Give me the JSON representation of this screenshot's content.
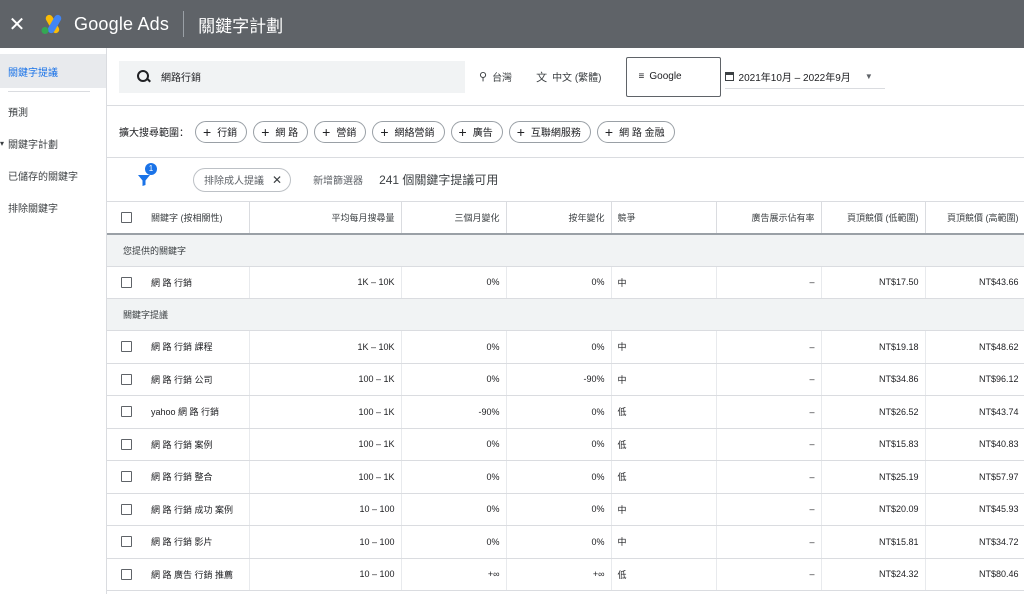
{
  "topbar": {
    "brand": "Google Ads",
    "page_title": "關鍵字計劃",
    "close_icon": "close-icon"
  },
  "sidebar": {
    "items": [
      {
        "label": "關鍵字提議"
      },
      {
        "label": "預測"
      },
      {
        "label": "關鍵字計劃"
      },
      {
        "label": "已儲存的關鍵字"
      },
      {
        "label": "排除關鍵字"
      }
    ]
  },
  "search": {
    "value": "網路行銷",
    "location": "台灣",
    "language": "中文 (繁體)",
    "network": "Google",
    "date_range": "2021年10月 – 2022年9月"
  },
  "expand": {
    "label": "擴大搜尋範圍：",
    "chips": [
      "行銷",
      "網 路",
      "營銷",
      "網絡營銷",
      "廣告",
      "互聯網服務",
      "網 路 金融"
    ]
  },
  "filter": {
    "badge": "1",
    "chip_label": "排除成人提議",
    "add_filter": "新增篩選器",
    "count_text": "241 個關鍵字提議可用"
  },
  "table": {
    "headers": [
      "關鍵字 (按相關性)",
      "平均每月搜尋量",
      "三個月變化",
      "按年變化",
      "競爭",
      "廣告展示佔有率",
      "頁頂競價 (低範圍)",
      "頁頂競價 (高範圍)"
    ],
    "group1": "您提供的關鍵字",
    "group2": "關鍵字提議",
    "provided": [
      {
        "keyword": "網 路 行銷",
        "volume": "1K – 10K",
        "three_month": "0%",
        "yoy": "0%",
        "competition": "中",
        "share": "–",
        "low": "NT$17.50",
        "high": "NT$43.66"
      }
    ],
    "ideas": [
      {
        "keyword": "網 路 行銷 課程",
        "volume": "1K – 10K",
        "three_month": "0%",
        "yoy": "0%",
        "competition": "中",
        "share": "–",
        "low": "NT$19.18",
        "high": "NT$48.62"
      },
      {
        "keyword": "網 路 行銷 公司",
        "volume": "100 – 1K",
        "three_month": "0%",
        "yoy": "-90%",
        "competition": "中",
        "share": "–",
        "low": "NT$34.86",
        "high": "NT$96.12"
      },
      {
        "keyword": "yahoo 網 路 行銷",
        "volume": "100 – 1K",
        "three_month": "-90%",
        "yoy": "0%",
        "competition": "低",
        "share": "–",
        "low": "NT$26.52",
        "high": "NT$43.74"
      },
      {
        "keyword": "網 路 行銷 案例",
        "volume": "100 – 1K",
        "three_month": "0%",
        "yoy": "0%",
        "competition": "低",
        "share": "–",
        "low": "NT$15.83",
        "high": "NT$40.83"
      },
      {
        "keyword": "網 路 行銷 整合",
        "volume": "100 – 1K",
        "three_month": "0%",
        "yoy": "0%",
        "competition": "低",
        "share": "–",
        "low": "NT$25.19",
        "high": "NT$57.97"
      },
      {
        "keyword": "網 路 行銷 成功 案例",
        "volume": "10 – 100",
        "three_month": "0%",
        "yoy": "0%",
        "competition": "中",
        "share": "–",
        "low": "NT$20.09",
        "high": "NT$45.93"
      },
      {
        "keyword": "網 路 行銷 影片",
        "volume": "10 – 100",
        "three_month": "0%",
        "yoy": "0%",
        "competition": "中",
        "share": "–",
        "low": "NT$15.81",
        "high": "NT$34.72"
      },
      {
        "keyword": "網 路 廣告 行銷 推薦",
        "volume": "10 – 100",
        "three_month": "+∞",
        "yoy": "+∞",
        "competition": "低",
        "share": "–",
        "low": "NT$24.32",
        "high": "NT$80.46"
      }
    ]
  },
  "colors": {
    "topbar": "#5f6368",
    "accent": "#1a73e8",
    "logo_blue": "#4285f4",
    "logo_yellow": "#fbbc04",
    "logo_green": "#34a853"
  }
}
